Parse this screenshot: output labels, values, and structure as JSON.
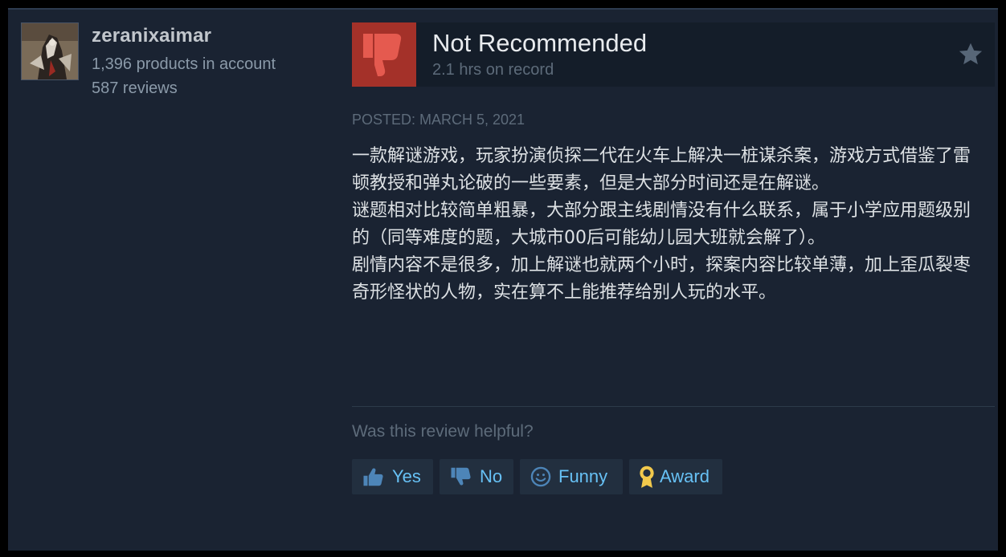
{
  "user": {
    "name": "zeranixaimar",
    "products": "1,396 products in account",
    "reviews": "587 reviews"
  },
  "review": {
    "verdict": "Not Recommended",
    "hours": "2.1 hrs on record",
    "posted": "POSTED: MARCH 5, 2021",
    "paragraphs": [
      "一款解谜游戏，玩家扮演侦探二代在火车上解决一桩谋杀案，游戏方式借鉴了雷顿教授和弹丸论破的一些要素，但是大部分时间还是在解谜。",
      "谜题相对比较简单粗暴，大部分跟主线剧情没有什么联系，属于小学应用题级别的（同等难度的题，大城市00后可能幼儿园大班就会解了）。",
      "剧情内容不是很多，加上解谜也就两个小时，探案内容比较单薄，加上歪瓜裂枣奇形怪状的人物，实在算不上能推荐给别人玩的水平。"
    ]
  },
  "feedback": {
    "question": "Was this review helpful?",
    "yes": "Yes",
    "no": "No",
    "funny": "Funny",
    "award": "Award"
  },
  "colors": {
    "panel": "#1a2332",
    "thumb_down_bg": "#a43129",
    "link": "#67c1f5",
    "award_icon": "#f2c94c"
  },
  "icons": [
    "thumbs-down-icon",
    "star-icon",
    "thumbs-up-icon",
    "smiley-icon",
    "award-ribbon-icon"
  ]
}
